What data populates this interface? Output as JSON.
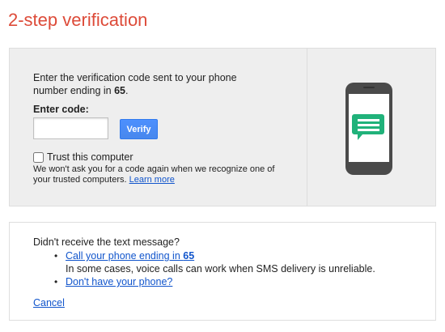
{
  "title": "2-step verification",
  "instructions": {
    "text": "Enter the verification code sent to your phone number ending in ",
    "phone_suffix": "65",
    "end": "."
  },
  "code": {
    "label": "Enter code:",
    "value": "",
    "placeholder": ""
  },
  "verify_label": "Verify",
  "trust": {
    "checked": false,
    "label": "Trust this computer",
    "note": "We won't ask you for a code again when we recognize one of your trusted computers. ",
    "learn_more": "Learn more"
  },
  "phone_icon": "phone-sms-icon",
  "colors": {
    "title": "#dd4b39",
    "link": "#1155cc",
    "button": "#4d90fe",
    "message_icon": "#20b27a",
    "phone_body": "#4a4a4a"
  },
  "no_sms": {
    "question": "Didn't receive the text message?",
    "call_link": "Call your phone ending in ",
    "call_suffix": "65",
    "call_note": "In some cases, voice calls can work when SMS delivery is unreliable.",
    "no_phone_link": "Don't have your phone?"
  },
  "cancel_label": "Cancel"
}
